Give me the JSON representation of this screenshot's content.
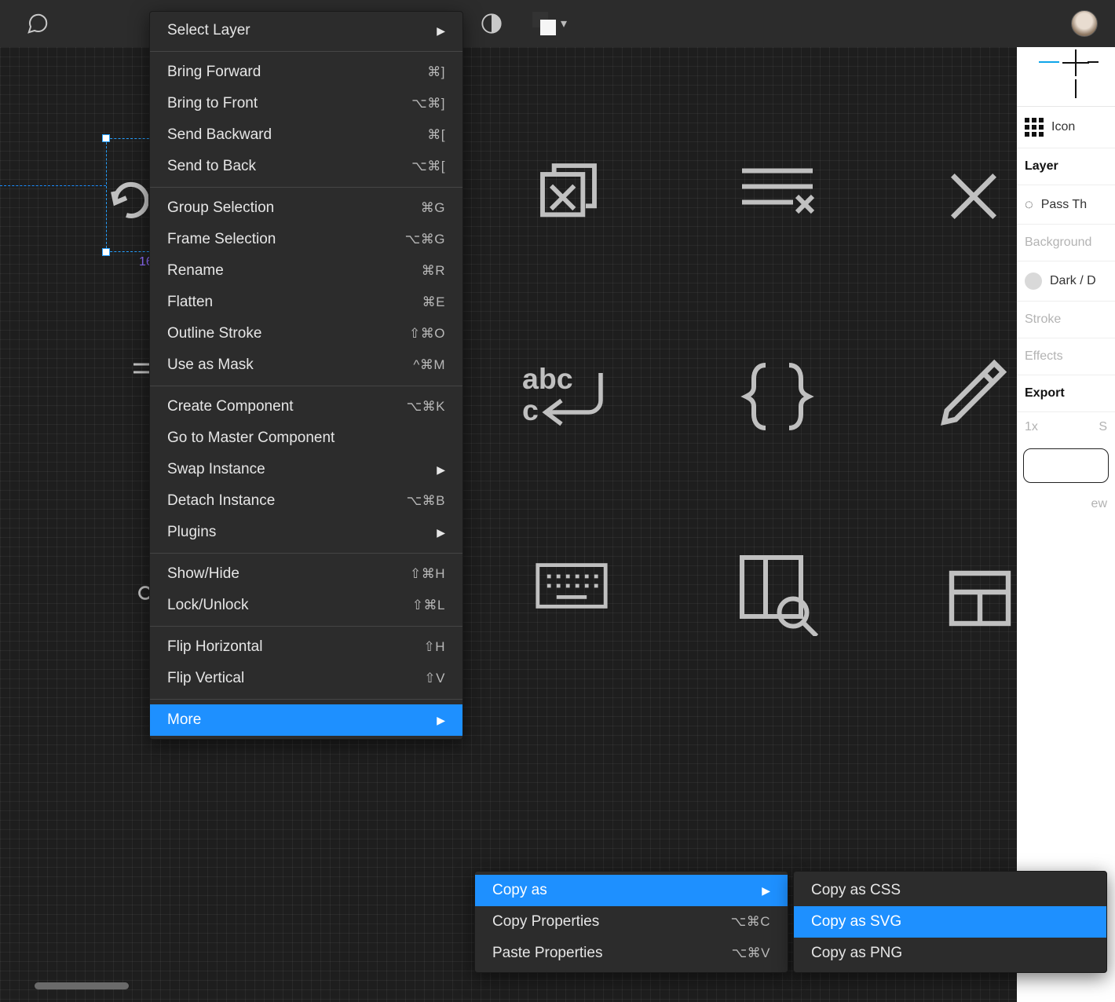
{
  "topbar": {
    "chat_icon": "chat-bubble",
    "contrast_icon": "contrast",
    "colors_icon": "color-swatches",
    "chevron": "▾",
    "avatar": "user-avatar"
  },
  "selection": {
    "label": "16"
  },
  "right_panel": {
    "component_label": "Icon",
    "layer_heading": "Layer",
    "layer_mode": "Pass Th",
    "background_heading": "Background",
    "background_swatch": "Dark / D",
    "stroke_heading": "Stroke",
    "effects_heading": "Effects",
    "export_heading": "Export",
    "export_scale": "1x",
    "export_suffix": "S",
    "preview_label": "ew"
  },
  "menu_main": [
    {
      "label": "Select Layer",
      "shortcut": "",
      "submenu": true
    },
    {
      "sep": true
    },
    {
      "label": "Bring Forward",
      "shortcut": "⌘]"
    },
    {
      "label": "Bring to Front",
      "shortcut": "⌥⌘]"
    },
    {
      "label": "Send Backward",
      "shortcut": "⌘["
    },
    {
      "label": "Send to Back",
      "shortcut": "⌥⌘["
    },
    {
      "sep": true
    },
    {
      "label": "Group Selection",
      "shortcut": "⌘G"
    },
    {
      "label": "Frame Selection",
      "shortcut": "⌥⌘G"
    },
    {
      "label": "Rename",
      "shortcut": "⌘R"
    },
    {
      "label": "Flatten",
      "shortcut": "⌘E"
    },
    {
      "label": "Outline Stroke",
      "shortcut": "⇧⌘O"
    },
    {
      "label": "Use as Mask",
      "shortcut": "^⌘M"
    },
    {
      "sep": true
    },
    {
      "label": "Create Component",
      "shortcut": "⌥⌘K"
    },
    {
      "label": "Go to Master Component",
      "shortcut": ""
    },
    {
      "label": "Swap Instance",
      "shortcut": "",
      "submenu": true
    },
    {
      "label": "Detach Instance",
      "shortcut": "⌥⌘B"
    },
    {
      "label": "Plugins",
      "shortcut": "",
      "submenu": true
    },
    {
      "sep": true
    },
    {
      "label": "Show/Hide",
      "shortcut": "⇧⌘H"
    },
    {
      "label": "Lock/Unlock",
      "shortcut": "⇧⌘L"
    },
    {
      "sep": true
    },
    {
      "label": "Flip Horizontal",
      "shortcut": "⇧H"
    },
    {
      "label": "Flip Vertical",
      "shortcut": "⇧V"
    },
    {
      "sep": true
    },
    {
      "label": "More",
      "shortcut": "",
      "submenu": true,
      "selected": true
    }
  ],
  "menu_copy": [
    {
      "label": "Copy as",
      "shortcut": "",
      "submenu": true,
      "selected": true
    },
    {
      "label": "Copy Properties",
      "shortcut": "⌥⌘C"
    },
    {
      "label": "Paste Properties",
      "shortcut": "⌥⌘V"
    }
  ],
  "menu_copyas": [
    {
      "label": "Copy as CSS",
      "shortcut": ""
    },
    {
      "label": "Copy as SVG",
      "shortcut": "",
      "selected": true
    },
    {
      "label": "Copy as PNG",
      "shortcut": ""
    }
  ]
}
